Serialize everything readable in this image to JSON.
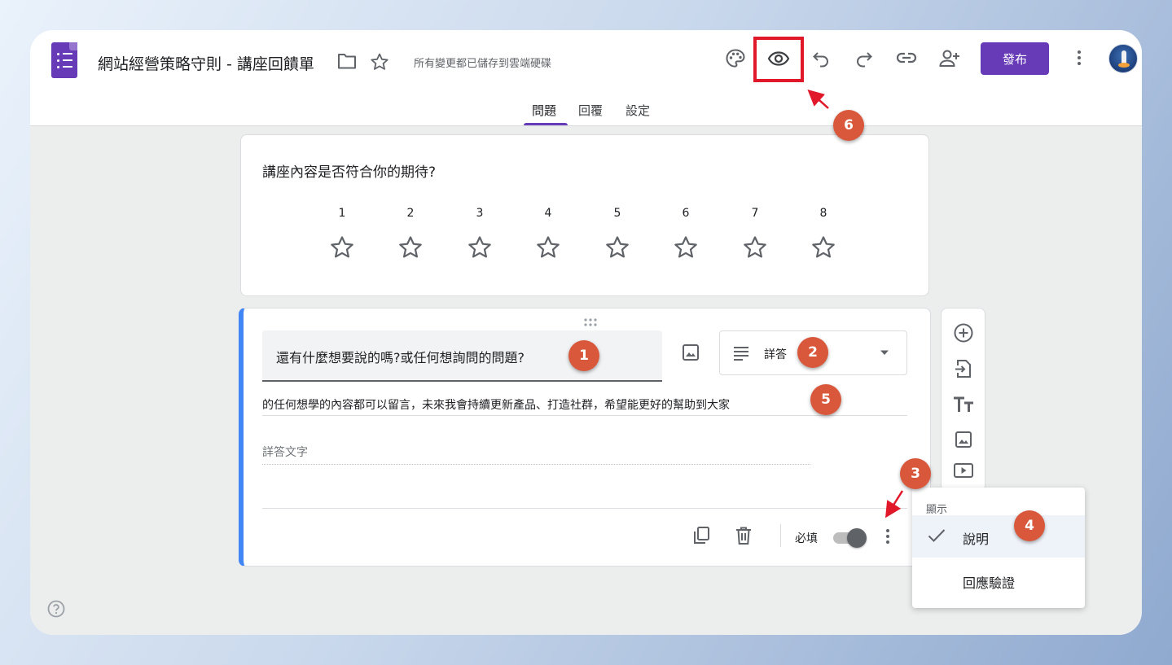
{
  "header": {
    "doc_title": "網站經營策略守則 - 講座回饋單",
    "save_status": "所有變更都已儲存到雲端硬碟",
    "publish_label": "發布",
    "icons": [
      "folder-icon",
      "star-icon",
      "palette-icon",
      "eye-icon",
      "undo-icon",
      "redo-icon",
      "link-icon",
      "add-person-icon",
      "more-vert-icon"
    ]
  },
  "tabs": [
    {
      "label": "問題",
      "active": true
    },
    {
      "label": "回覆",
      "active": false
    },
    {
      "label": "設定",
      "active": false
    }
  ],
  "question1": {
    "title": "講座內容是否符合你的期待?",
    "scale": [
      "1",
      "2",
      "3",
      "4",
      "5",
      "6",
      "7",
      "8"
    ],
    "symbol": "star-outline-icon"
  },
  "question2": {
    "title": "還有什麼想要說的嗎?或任何想詢問的問題?",
    "type_label": "詳答",
    "description": "的任何想學的內容都可以留言，未來我會持續更新產品、打造社群，希望能更好的幫助到大家",
    "answer_placeholder": "詳答文字",
    "required_label": "必填",
    "required_on": true
  },
  "side_toolbar": [
    "add-circle-icon",
    "import-icon",
    "title-text-icon",
    "image-icon",
    "video-icon"
  ],
  "menu": {
    "header": "顯示",
    "items": [
      {
        "label": "說明",
        "checked": true
      },
      {
        "label": "回應驗證",
        "checked": false
      }
    ]
  },
  "badges": [
    "1",
    "2",
    "3",
    "4",
    "5",
    "6"
  ],
  "colors": {
    "brand": "#673ab7",
    "accent_blue": "#4285f4",
    "badge": "#d9583c",
    "highlight": "#e0182a"
  }
}
